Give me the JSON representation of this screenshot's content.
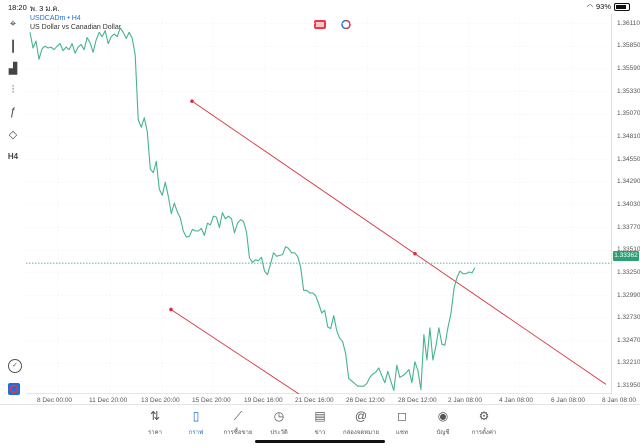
{
  "status": {
    "time": "18:20",
    "date": "พ. 3 ม.ค.",
    "battery": "93%"
  },
  "chart": {
    "symbol": "USDCADm • H4",
    "description": "US Dollar vs Canadian Dollar",
    "current_price": "1.33362",
    "colors": {
      "line": "#46b48c",
      "trend": "#d9333f",
      "price_line": "#2e9f73",
      "accent": "#1e6fd9"
    }
  },
  "toolbar": {
    "items": [
      {
        "name": "crosshair-icon",
        "glyph": "⌖"
      },
      {
        "name": "chart-type-icon",
        "glyph": "┃"
      },
      {
        "name": "indicators-icon",
        "glyph": "▟"
      },
      {
        "name": "objects-icon",
        "glyph": "⫶"
      },
      {
        "name": "function-icon",
        "glyph": "ƒ"
      },
      {
        "name": "shapes-icon",
        "glyph": "◇"
      },
      {
        "name": "timeframe-label",
        "glyph": "H4"
      }
    ]
  },
  "chart_data": {
    "type": "line",
    "title": "",
    "xlabel": "",
    "ylabel": "",
    "y_ticks": [
      "1.36110",
      "1.35850",
      "1.35590",
      "1.35330",
      "1.35070",
      "1.34810",
      "1.34550",
      "1.34290",
      "1.34030",
      "1.33770",
      "1.33510",
      "1.33250",
      "1.32990",
      "1.32730",
      "1.32470",
      "1.32210",
      "1.31950"
    ],
    "x_ticks": [
      "8 Dec 00:00",
      "11 Dec 20:00",
      "13 Dec 20:00",
      "15 Dec 20:00",
      "19 Dec 16:00",
      "21 Dec 16:00",
      "26 Dec 12:00",
      "28 Dec 12:00",
      "2 Jan 08:00",
      "4 Jan 08:00",
      "6 Jan 08:00",
      "8 Jan 08:00"
    ],
    "ylim": [
      1.3186,
      1.3622
    ],
    "grid": true,
    "series": [
      {
        "values": [
          1.3601,
          1.3583,
          1.3591,
          1.357,
          1.3582,
          1.3585,
          1.3583,
          1.3584,
          1.3581,
          1.3585,
          1.3588,
          1.358,
          1.3584,
          1.3581,
          1.3588,
          1.3577,
          1.3584,
          1.3587,
          1.3581,
          1.3595,
          1.3589,
          1.3578,
          1.3592,
          1.3601,
          1.3596,
          1.3603,
          1.3588,
          1.3596,
          1.3599,
          1.3596,
          1.3606,
          1.3601,
          1.3594,
          1.3601,
          1.3594,
          1.3575,
          1.3501,
          1.3492,
          1.3503,
          1.3487,
          1.3444,
          1.344,
          1.3453,
          1.3421,
          1.3414,
          1.3429,
          1.3413,
          1.3393,
          1.3405,
          1.3395,
          1.3388,
          1.3373,
          1.3366,
          1.3367,
          1.3375,
          1.3373,
          1.3373,
          1.3376,
          1.3368,
          1.3382,
          1.338,
          1.339,
          1.3389,
          1.3377,
          1.3394,
          1.3387,
          1.339,
          1.3387,
          1.3371,
          1.3382,
          1.3386,
          1.3384,
          1.3372,
          1.3342,
          1.3337,
          1.334,
          1.3339,
          1.3343,
          1.3327,
          1.3323,
          1.3335,
          1.3348,
          1.3344,
          1.3345,
          1.3346,
          1.3355,
          1.3353,
          1.3348,
          1.3348,
          1.3344,
          1.3332,
          1.3305,
          1.3305,
          1.3302,
          1.3302,
          1.3299,
          1.329,
          1.3279,
          1.3282,
          1.3263,
          1.3261,
          1.3276,
          1.3259,
          1.325,
          1.3246,
          1.3232,
          1.3204,
          1.3201,
          1.3198,
          1.3195,
          1.3195,
          1.3195,
          1.3198,
          1.3205,
          1.3209,
          1.3211,
          1.3216,
          1.3207,
          1.3199,
          1.3212,
          1.3201,
          1.319,
          1.3219,
          1.3205,
          1.3207,
          1.321,
          1.3214,
          1.3199,
          1.3223,
          1.3213,
          1.3191,
          1.3254,
          1.3225,
          1.3262,
          1.3225,
          1.3241,
          1.3262,
          1.3243,
          1.3242,
          1.3262,
          1.3278,
          1.3307,
          1.332,
          1.3327,
          1.3324,
          1.3324,
          1.3326,
          1.3325,
          1.3331
        ]
      }
    ],
    "trendlines": [
      {
        "x1": "2023-12-13 20:00",
        "y1": 1.3522,
        "x2": "2024-01-08 08:00",
        "y2": 1.3197
      },
      {
        "x1": "2023-12-13 16:00",
        "y1": 1.3283,
        "x2": "2023-12-26 00:00",
        "y2": 1.317
      }
    ],
    "current_price": 1.33362
  },
  "nav": {
    "items": [
      {
        "icon": "⇅",
        "label": "ราคา",
        "icon_name": "quotes-icon"
      },
      {
        "icon": "▯",
        "label": "กราฟ",
        "icon_name": "chart-icon"
      },
      {
        "icon": "⟋",
        "label": "การซื้อขาย",
        "icon_name": "trade-icon"
      },
      {
        "icon": "◷",
        "label": "ประวัติ",
        "icon_name": "history-icon"
      },
      {
        "icon": "▤",
        "label": "ข่าว",
        "icon_name": "news-icon"
      },
      {
        "icon": "@",
        "label": "กล่องจดหมาย",
        "icon_name": "mailbox-icon"
      },
      {
        "icon": "◻",
        "label": "แชท",
        "icon_name": "chat-icon"
      },
      {
        "icon": "◉",
        "label": "บัญชี",
        "icon_name": "account-icon"
      },
      {
        "icon": "⚙",
        "label": "การตั้งค่า",
        "icon_name": "settings-icon"
      }
    ],
    "active_index": 1
  }
}
